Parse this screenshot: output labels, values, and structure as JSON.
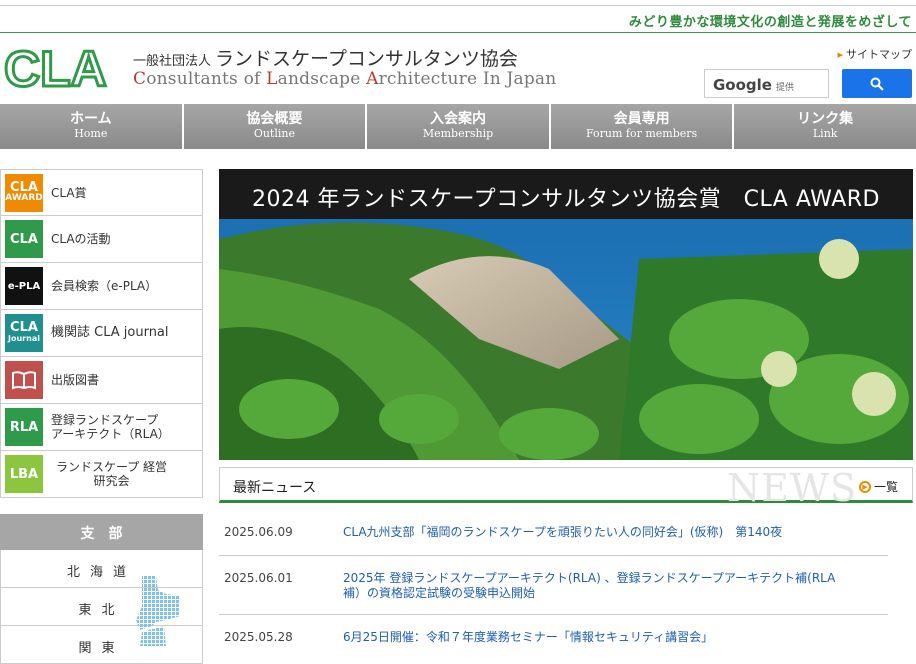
{
  "header": {
    "tagline": "みどり豊かな環境文化の創造と発展をめざして",
    "logo_text": "CLA",
    "org_prefix": "一般社団法人",
    "org_name_jp": "ランドスケープコンサルタンツ協会",
    "org_name_en_parts": [
      "C",
      "onsultants of ",
      "L",
      "andscape ",
      "A",
      "rchitecture In Japan"
    ],
    "sitemap_label": "サイトマップ",
    "search": {
      "brand": "Google",
      "sub": "提供"
    }
  },
  "nav": [
    {
      "jp": "ホーム",
      "en": "Home"
    },
    {
      "jp": "協会概要",
      "en": "Outline"
    },
    {
      "jp": "入会案内",
      "en": "Membership"
    },
    {
      "jp": "会員専用",
      "en": "Forum for members"
    },
    {
      "jp": "リンク集",
      "en": "Link"
    }
  ],
  "sidebar": [
    {
      "icon_text": [
        "CLA",
        "AWARD"
      ],
      "label": "CLA賞",
      "color": "#f08a00"
    },
    {
      "icon_text": [
        "CLA"
      ],
      "label": "CLAの活動",
      "color": "#2e9a4a"
    },
    {
      "icon_text": [
        "e-PLA"
      ],
      "label": "会員検索（e-PLA）",
      "color": "#111111"
    },
    {
      "icon_text": [
        "CLA",
        "Journal"
      ],
      "label": "機関誌 CLA journal",
      "color": "#1f8f8f"
    },
    {
      "icon_text": [],
      "label": "出版図書",
      "color": "#c0504d"
    },
    {
      "icon_text": [
        "RLA"
      ],
      "label": "登録ランドスケープ アーキテクト（RLA）",
      "color": "#2e9a4a"
    },
    {
      "icon_text": [
        "LBA"
      ],
      "label": "ランドスケープ 経営研究会",
      "color": "#8cc63f"
    }
  ],
  "branches": {
    "title": "支部",
    "items": [
      "北海道",
      "東北",
      "関東"
    ]
  },
  "hero": {
    "title": "2024 年ランドスケープコンサルタンツ協会賞　CLA AWARD"
  },
  "news": {
    "title": "最新ニュース",
    "bg_text": "NEWS",
    "all_label": "一覧",
    "items": [
      {
        "date": "2025.06.09",
        "text": "CLA九州支部「福岡のランドスケープを頑張りたい人の同好会」(仮称)　第140夜"
      },
      {
        "date": "2025.06.01",
        "text": "2025年 登録ランドスケープアーキテクト(RLA) 、登録ランドスケープアーキテクト補(RLA補）の資格認定試験の受験申込開始"
      },
      {
        "date": "2025.05.28",
        "text": "6月25日開催：令和７年度業務セミナー「情報セキュリティ講習会」"
      }
    ]
  }
}
